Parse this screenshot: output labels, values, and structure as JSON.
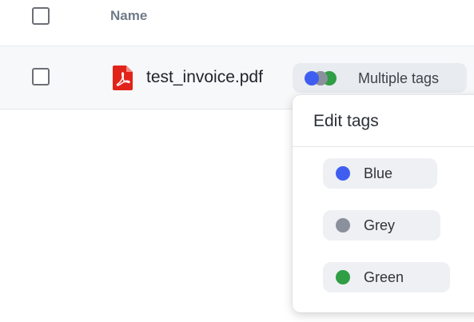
{
  "table": {
    "header": {
      "name_label": "Name"
    },
    "rows": [
      {
        "file_name": "test_invoice.pdf",
        "file_type_icon": "pdf-file-icon",
        "tags_label": "Multiple tags"
      }
    ]
  },
  "tag_colors": {
    "blue": "#3f5ef0",
    "grey": "#8a909c",
    "green": "#2f9e44"
  },
  "tags_popover": {
    "title": "Edit tags",
    "options": [
      {
        "label": "Blue",
        "color": "#3f5ef0"
      },
      {
        "label": "Grey",
        "color": "#8a909c"
      },
      {
        "label": "Green",
        "color": "#2f9e44"
      }
    ]
  }
}
